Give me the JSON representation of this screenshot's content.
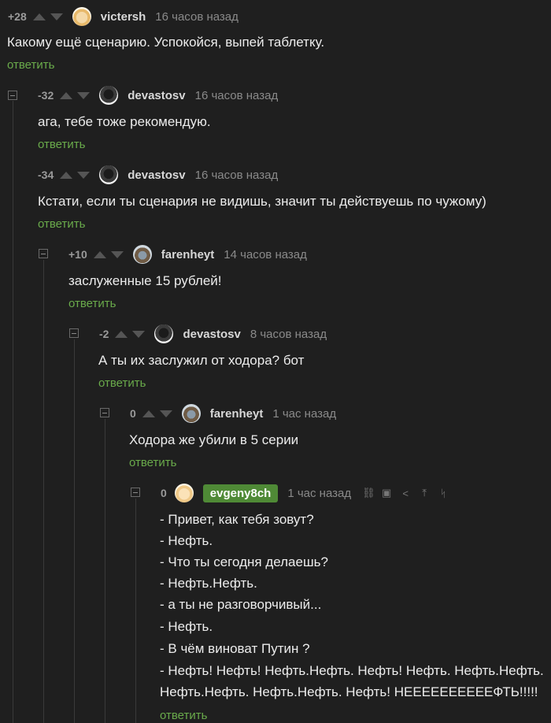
{
  "reply_label": "ответить",
  "comments": [
    {
      "rating": "+28",
      "author": "victersh",
      "time": "16 часов назад",
      "text": "Какому ещё сценарию. Успокойся, выпей таблетку."
    },
    {
      "rating": "-32",
      "author": "devastosv",
      "time": "16 часов назад",
      "text": "ага, тебе тоже рекомендую."
    },
    {
      "rating": "-34",
      "author": "devastosv",
      "time": "16 часов назад",
      "text": "Кстати, если ты сценария не видишь, значит ты действуешь по чужому)"
    },
    {
      "rating": "+10",
      "author": "farenheyt",
      "time": "14 часов назад",
      "text": "заслуженные 15 рублей!"
    },
    {
      "rating": "-2",
      "author": "devastosv",
      "time": "8 часов назад",
      "text": "А ты их заслужил от ходора? бот"
    },
    {
      "rating": "0",
      "author": "farenheyt",
      "time": "1 час назад",
      "text": "Ходора же убили в 5 серии"
    },
    {
      "rating": "0",
      "author": "evgeny8ch",
      "time": "1 час назад",
      "lines": [
        "- Привет, как тебя зовут?",
        "- Нефть.",
        "- Что ты сегодня делаешь?",
        "- Нефть.Нефть.",
        "- а ты не разговорчивый...",
        "- Нефть.",
        "- В чём виноват Путин ?",
        "- Нефть! Нефть! Нефть.Нефть. Нефть! Нефть. Нефть.Нефть.",
        "Нефть.Нефть. Нефть.Нефть. Нефть! НЕЕЕЕЕЕЕЕЕЕФТЬ!!!!!"
      ]
    }
  ],
  "icons": {
    "avatar_victersh": "avatar-icon",
    "avatar_devastosv": "avatar-icon",
    "avatar_farenheyt": "avatar-icon",
    "avatar_evgeny8ch": "avatar-icon",
    "tools": [
      "link-icon",
      "save-icon",
      "share-icon",
      "scroll-up-icon",
      "branch-icon"
    ]
  },
  "colors": {
    "background": "#1f1f1f",
    "reply_link": "#6aab4b",
    "author_badge": "#4f8a36"
  }
}
